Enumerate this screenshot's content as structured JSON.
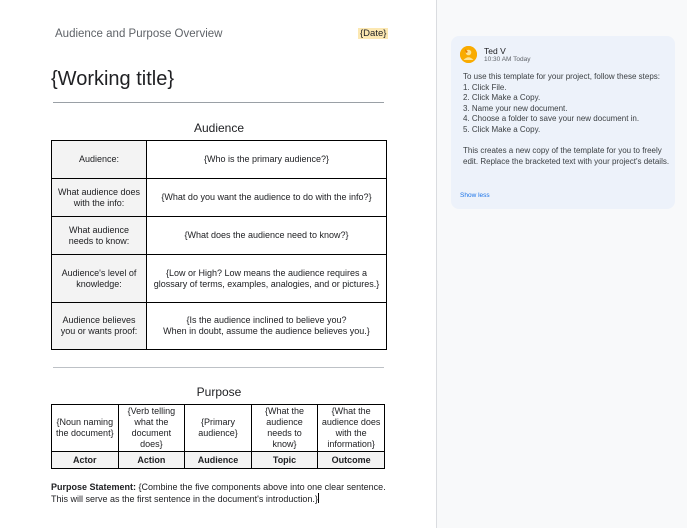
{
  "document": {
    "header_title": "Audience and Purpose Overview",
    "date_placeholder": "{Date}",
    "working_title": "{Working title}",
    "audience_section": {
      "heading": "Audience",
      "rows": [
        {
          "label": "Audience:",
          "value": "{Who is the primary audience?}"
        },
        {
          "label": "What audience does with the info:",
          "value": "{What do you want the audience to do with the info?}"
        },
        {
          "label": "What audience needs to know:",
          "value": "{What does the audience need to know?}"
        },
        {
          "label": "Audience's level of knowledge:",
          "value": "{Low or High? Low means the audience requires a glossary of terms, examples, analogies, and or pictures.}"
        },
        {
          "label": "Audience believes you or wants proof:",
          "value_line1": "{Is the audience inclined to believe you?",
          "value_line2": "When in doubt, assume the audience believes you.}"
        }
      ]
    },
    "purpose_section": {
      "heading": "Purpose",
      "cells": [
        "{Noun naming the document}",
        "{Verb telling what the document does}",
        "{Primary audience}",
        "{What the audience needs to know}",
        "{What the audience does with the information}"
      ],
      "headers": [
        "Actor",
        "Action",
        "Audience",
        "Topic",
        "Outcome"
      ]
    },
    "purpose_statement": {
      "label": "Purpose Statement:",
      "text": " {Combine the five components above into one clear sentence. This will serve as the first sentence in the document's introduction.}"
    }
  },
  "comment": {
    "author": "Ted V",
    "timestamp": "10:30 AM Today",
    "intro": "To use this template for your project, follow these steps:",
    "steps": [
      "1. Click File.",
      "2. Click Make a Copy.",
      "3. Name your new document.",
      "4. Choose a folder to save your new document in.",
      "5. Click Make a Copy."
    ],
    "closing": "This creates a new copy of the template for you to freely edit. Replace the bracketed text with your project's details.",
    "show_less": "Show less",
    "avatar_icon": "user-avatar-icon"
  }
}
